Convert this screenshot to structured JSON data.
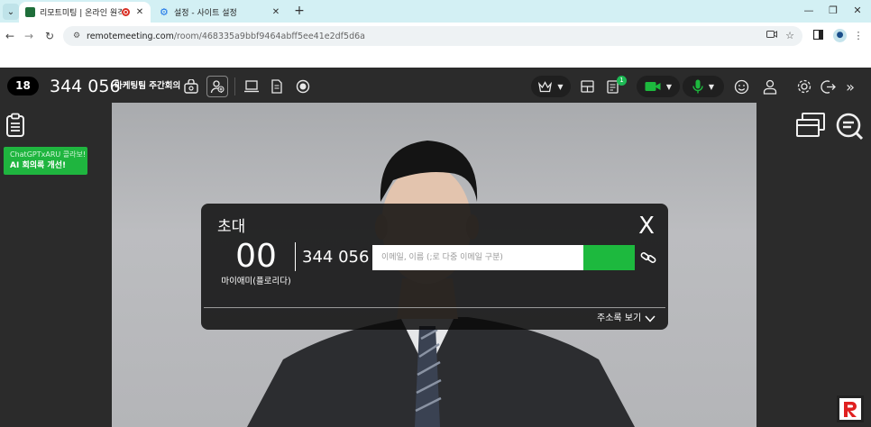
{
  "browser": {
    "tabs": [
      {
        "title": "리모트미팅 | 온라인 원격미",
        "active": true
      },
      {
        "title": "설정 - 사이트 설정",
        "active": false
      }
    ],
    "url_host": "remotemeeting.com",
    "url_path": "/room/468335a9bbf9464abff5ee41e2df5d6a"
  },
  "topbar": {
    "participant_count": "18",
    "room_number": "344 056",
    "room_name": "마케팅팀 주간회의",
    "chat_badge": "1"
  },
  "promo": {
    "line1": "ChatGPTxARU 콜라보!",
    "line2": "AI 회의록 개선!"
  },
  "invite": {
    "title": "초대",
    "count": "00",
    "host_name": "마이애미(플로리다)",
    "room_number": "344 056",
    "email_placeholder": "이메일, 이름 (;로 다중 이메일 구분)",
    "close_label": "X",
    "address_book_label": "주소록 보기"
  },
  "colors": {
    "accent_green": "#1db93e",
    "toolbar_dark": "#2b2b2b",
    "tabstrip": "#d3f0f4"
  }
}
